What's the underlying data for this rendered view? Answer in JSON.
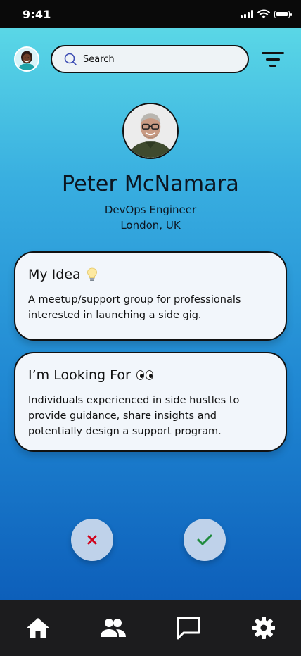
{
  "status_bar": {
    "time": "9:41"
  },
  "header": {
    "search": {
      "placeholder": "Search"
    },
    "icons": {
      "avatar": "user-avatar",
      "filter": "filter-icon",
      "search": "search-icon"
    }
  },
  "profile": {
    "name": "Peter McNamara",
    "role": "DevOps Engineer",
    "location": "London, UK"
  },
  "cards": {
    "idea": {
      "title": "My Idea",
      "emoji": "lightbulb",
      "body": "A meetup/support group for professionals interested in launching a side gig."
    },
    "looking_for": {
      "title": "I’m Looking For",
      "emoji": "eyes",
      "body": "Individuals experienced in side hustles to provide guidance, share insights and potentially design a support program."
    }
  },
  "actions": {
    "reject": {
      "icon": "close-icon",
      "color": "#d0021b"
    },
    "accept": {
      "icon": "check-icon",
      "color": "#1e8a3c"
    }
  },
  "tab_bar": {
    "items": [
      {
        "icon": "home-icon"
      },
      {
        "icon": "people-icon"
      },
      {
        "icon": "chat-icon"
      },
      {
        "icon": "settings-icon"
      }
    ]
  },
  "colors": {
    "gradient_top": "#5ad7e6",
    "gradient_bottom": "#0d5fba",
    "tab_bar": "#1c1c1e",
    "action_button": "#bfd2ea"
  }
}
